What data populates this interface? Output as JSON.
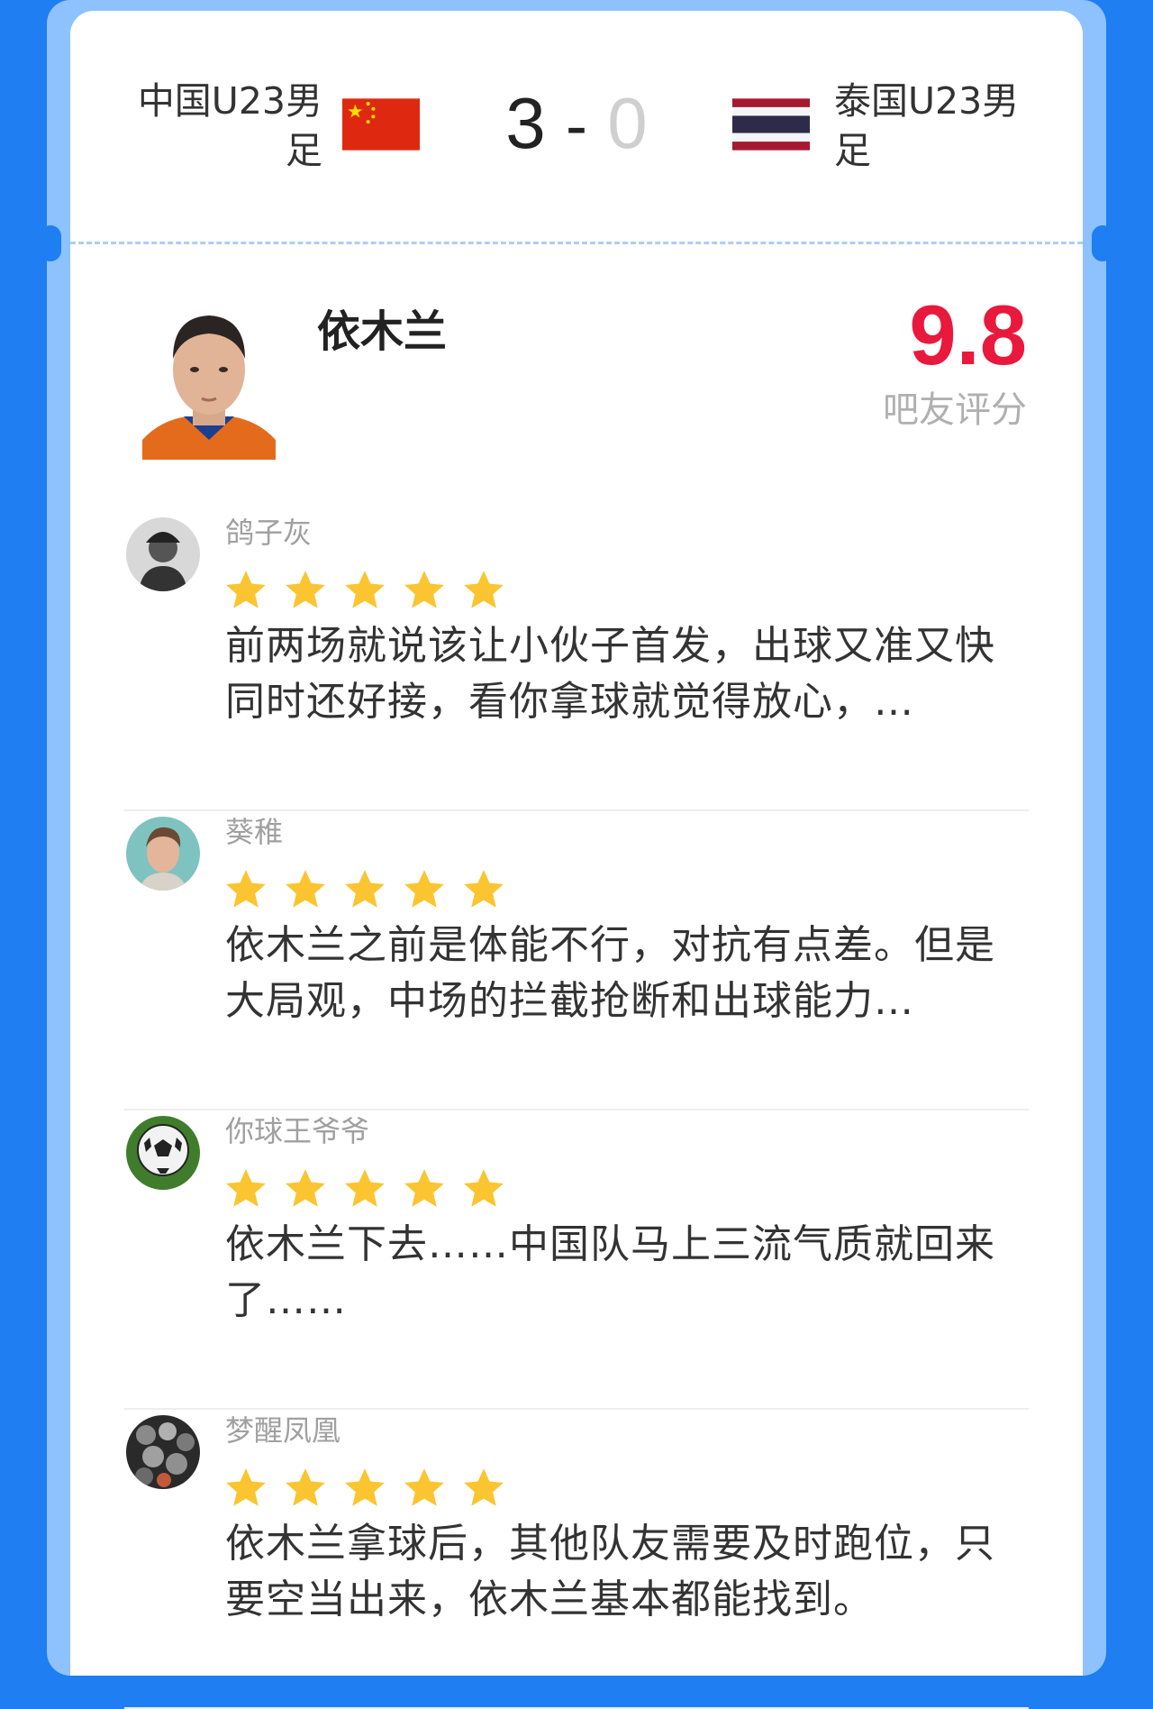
{
  "match": {
    "home_team": "中国U23男足",
    "away_team": "泰国U23男足",
    "home_score": "3",
    "separator": "-",
    "away_score": "0"
  },
  "player": {
    "name": "依木兰",
    "rating": "9.8",
    "rating_label": "吧友评分"
  },
  "colors": {
    "accent_blue": "#1e7ef2",
    "rating_red": "#e8193d",
    "star_gold": "#fbc531"
  },
  "comments": [
    {
      "username": "鸽子灰",
      "stars": 5,
      "text": "前两场就说该让小伙子首发，出球又准又快同时还好接，看你拿球就觉得放心，…"
    },
    {
      "username": "葵稚",
      "stars": 5,
      "text": "依木兰之前是体能不行，对抗有点差。但是大局观，中场的拦截抢断和出球能力…"
    },
    {
      "username": "你球王爷爷",
      "stars": 5,
      "text": "依木兰下去……中国队马上三流气质就回来了……"
    },
    {
      "username": "梦醒凤凰",
      "stars": 5,
      "text": "依木兰拿球后，其他队友需要及时跑位，只要空当出来，依木兰基本都能找到。"
    }
  ]
}
